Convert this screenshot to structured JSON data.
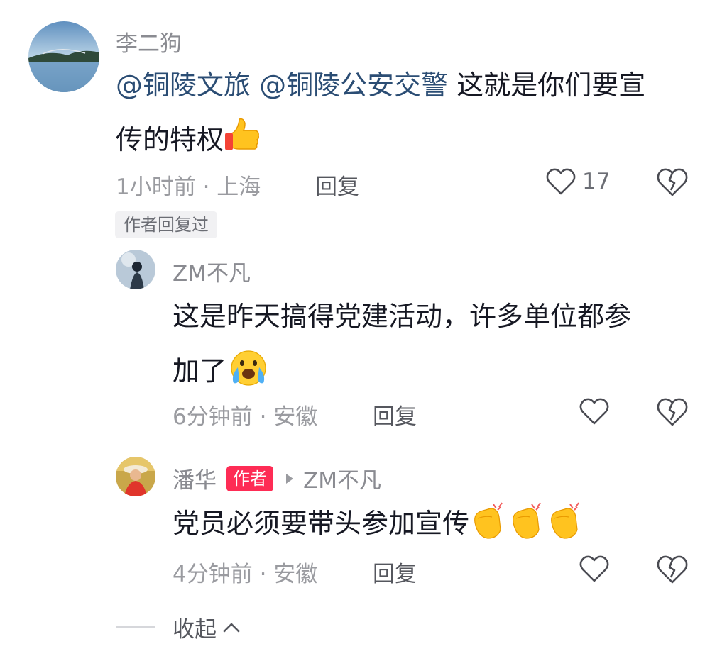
{
  "comments": [
    {
      "username": "李二狗",
      "mentions": [
        "@铜陵文旅",
        "@铜陵公安交警"
      ],
      "text_line1": " 这就是你们要宣",
      "text_line2": "传的特权",
      "emoji": "thumbs-up",
      "time": "1小时前",
      "location": "上海",
      "reply_label": "回复",
      "likes": "17",
      "author_replied_badge": "作者回复过"
    }
  ],
  "replies": [
    {
      "username": "ZM不凡",
      "text_line1": "这是昨天搞得党建活动，许多单位都参",
      "text_line2": "加了",
      "emoji": "crying-face",
      "time": "6分钟前",
      "location": "安徽",
      "reply_label": "回复"
    },
    {
      "username": "潘华",
      "author_tag": "作者",
      "reply_to": "ZM不凡",
      "text": "党员必须要带头参加宣传",
      "emoji": "clapping-hands",
      "time": "4分钟前",
      "location": "安徽",
      "reply_label": "回复"
    }
  ],
  "collapse_label": "收起",
  "colors": {
    "mention": "#2b4d74",
    "author_tag": "#fe2c55",
    "meta": "#9a9ba0"
  }
}
